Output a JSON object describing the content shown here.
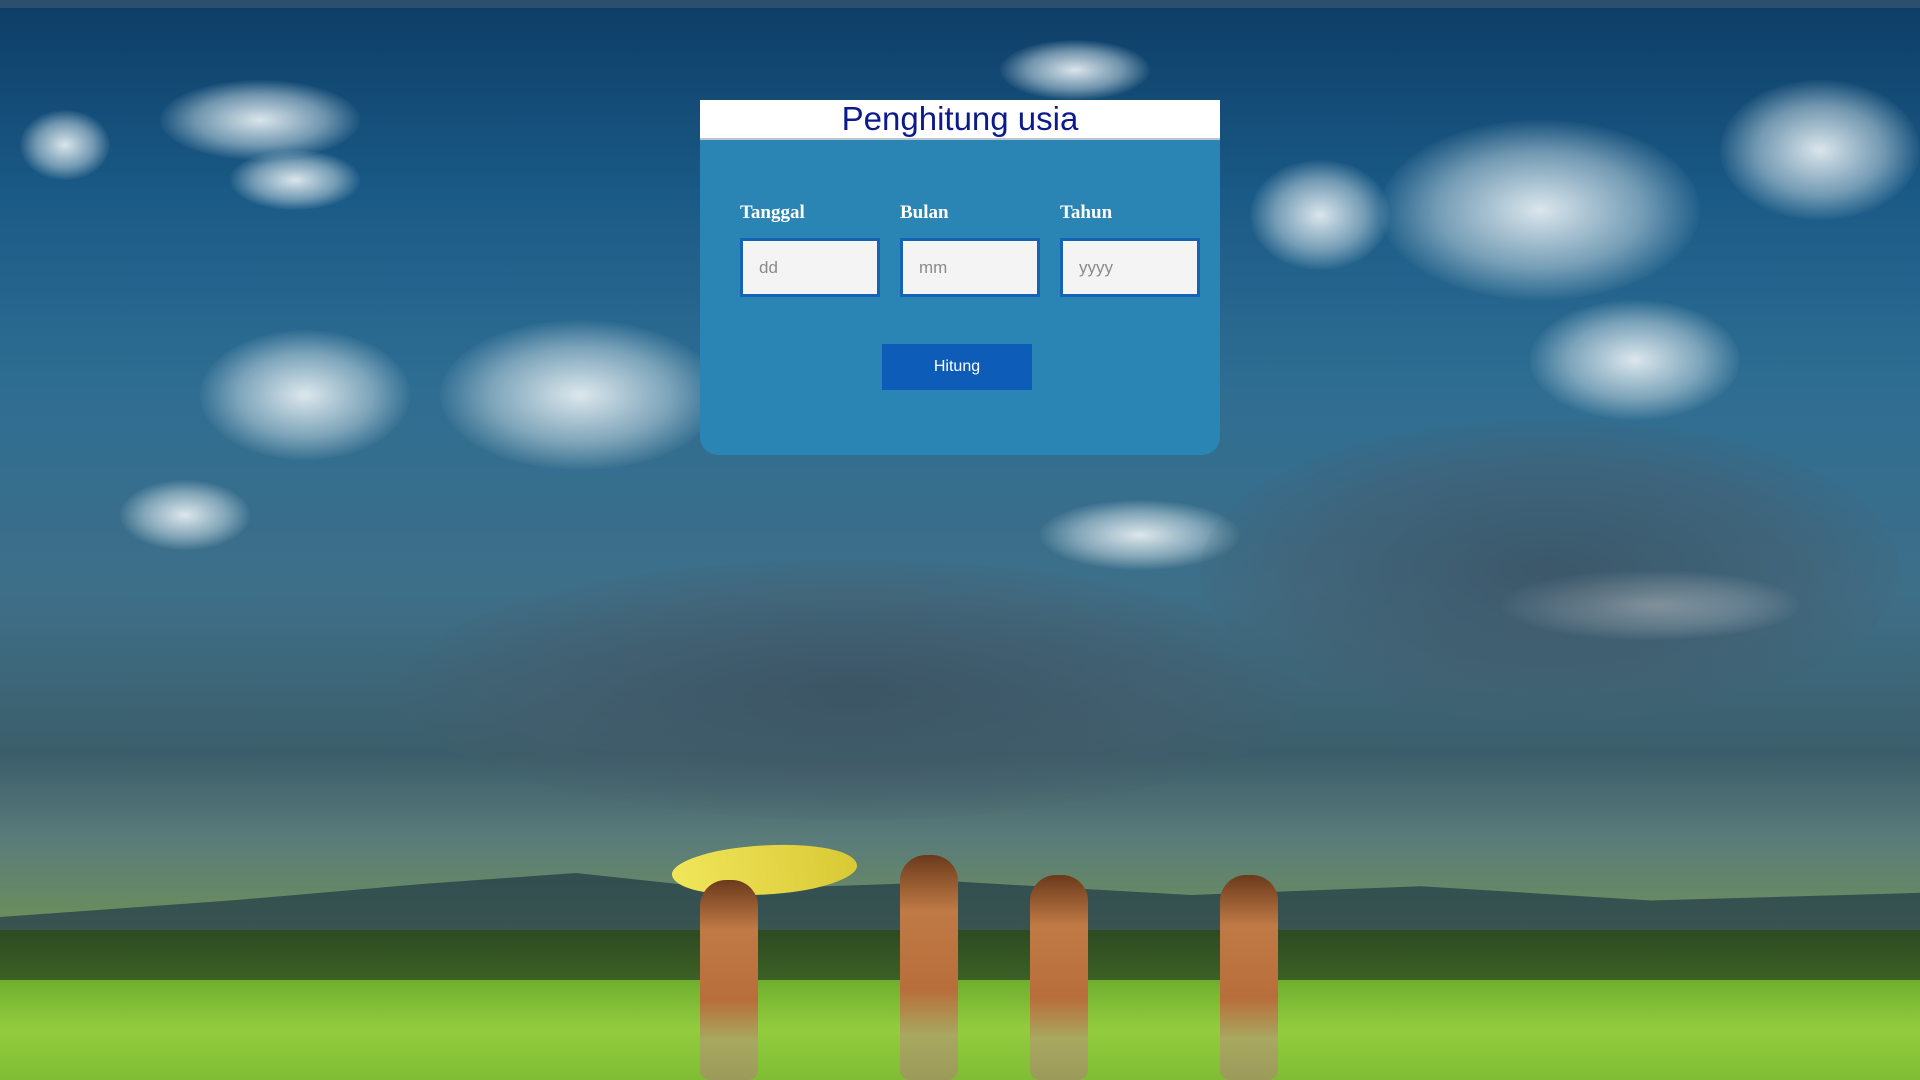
{
  "page": {
    "title": "Penghitung usia"
  },
  "form": {
    "fields": [
      {
        "label": "Tanggal",
        "placeholder": "dd",
        "value": ""
      },
      {
        "label": "Bulan",
        "placeholder": "mm",
        "value": ""
      },
      {
        "label": "Tahun",
        "placeholder": "yyyy",
        "value": ""
      }
    ],
    "submit_label": "Hitung"
  },
  "colors": {
    "card": "#2a84b4",
    "title": "#0c1a8c",
    "button": "#0d5db8",
    "input_border": "#1663b5"
  }
}
